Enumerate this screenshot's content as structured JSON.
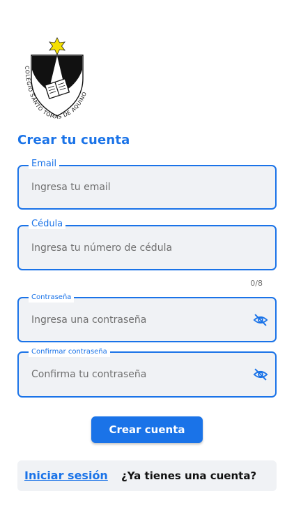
{
  "header": {
    "logo_text": "COLEGIO SANTO TOMAS DE AQUINO"
  },
  "form": {
    "title": "Crear tu cuenta",
    "email": {
      "label": "Email",
      "placeholder": "Ingresa tu email"
    },
    "cedula": {
      "label": "Cédula",
      "placeholder": "Ingresa tu número de cédula",
      "counter": "0/8"
    },
    "password": {
      "label": "Contraseña",
      "placeholder": "Ingresa una contraseña",
      "icon": "eye-off-icon"
    },
    "confirm_password": {
      "label": "Confirmar contraseña",
      "placeholder": "Confirma tu contraseña",
      "icon": "eye-off-icon"
    },
    "submit_label": "Crear cuenta"
  },
  "footer": {
    "login_link": "Iniciar sesión",
    "have_account": "¿Ya tienes una cuenta?"
  },
  "colors": {
    "primary": "#1a73e8",
    "field_bg": "#f0f2f5",
    "logo_star": "#f5e000"
  }
}
